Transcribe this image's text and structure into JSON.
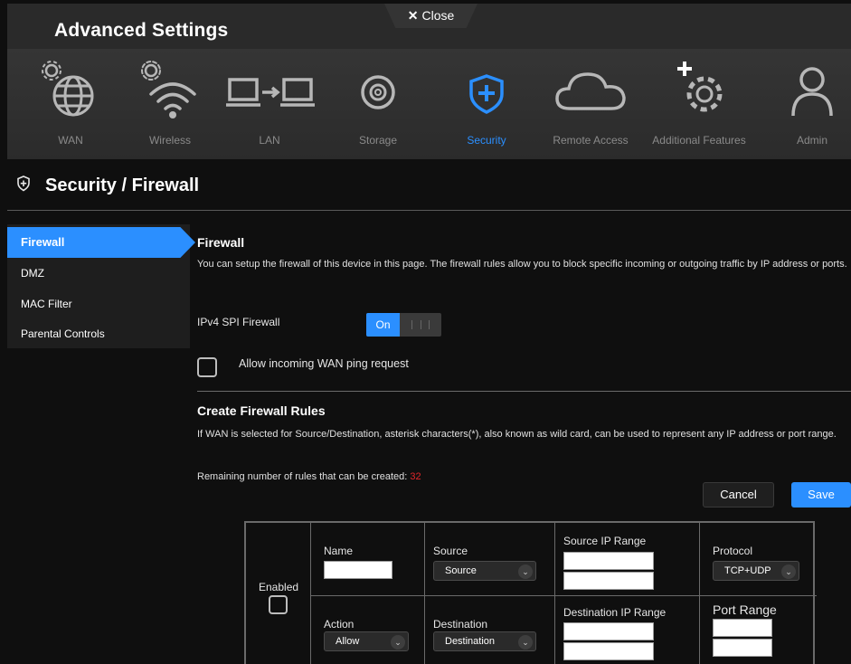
{
  "header": {
    "title": "Advanced Settings",
    "close_label": "Close"
  },
  "nav": {
    "items": [
      {
        "label": "WAN",
        "icon": "globe-gear-icon"
      },
      {
        "label": "Wireless",
        "icon": "wifi-gear-icon"
      },
      {
        "label": "LAN",
        "icon": "lan-computers-icon"
      },
      {
        "label": "Storage",
        "icon": "storage-disc-icon"
      },
      {
        "label": "Security",
        "icon": "shield-plus-icon",
        "active": true
      },
      {
        "label": "Remote Access",
        "icon": "cloud-icon"
      },
      {
        "label": "Additional Features",
        "icon": "gear-plus-icon"
      },
      {
        "label": "Admin",
        "icon": "user-icon"
      }
    ]
  },
  "page": {
    "title": "Security / Firewall"
  },
  "sidebar": {
    "items": [
      {
        "label": "Firewall",
        "active": true
      },
      {
        "label": "DMZ"
      },
      {
        "label": "MAC Filter"
      },
      {
        "label": "Parental Controls"
      }
    ]
  },
  "firewall": {
    "heading": "Firewall",
    "description": "You can setup the firewall of this device in this page. The firewall rules allow you to block specific incoming or outgoing traffic by IP address or ports.",
    "spi_label": "IPv4 SPI Firewall",
    "spi_state": "On",
    "ping_label": "Allow incoming WAN ping request"
  },
  "rules": {
    "heading": "Create Firewall Rules",
    "description": "If WAN is selected for Source/Destination, asterisk characters(*), also known as wild card, can be used to represent any IP address or port range.",
    "remaining_label": "Remaining number of rules that can be created:",
    "remaining_count": "32",
    "cancel_label": "Cancel",
    "save_label": "Save",
    "table": {
      "enabled_label": "Enabled",
      "name_label": "Name",
      "action_label": "Action",
      "action_value": "Allow",
      "source_label": "Source",
      "source_value": "Source",
      "destination_label": "Destination",
      "destination_value": "Destination",
      "source_ip_label": "Source IP Range",
      "dest_ip_label": "Destination IP Range",
      "protocol_label": "Protocol",
      "protocol_value": "TCP+UDP",
      "port_range_label": "Port Range"
    }
  },
  "colors": {
    "accent": "#2b8fff",
    "count": "#e0262a"
  }
}
